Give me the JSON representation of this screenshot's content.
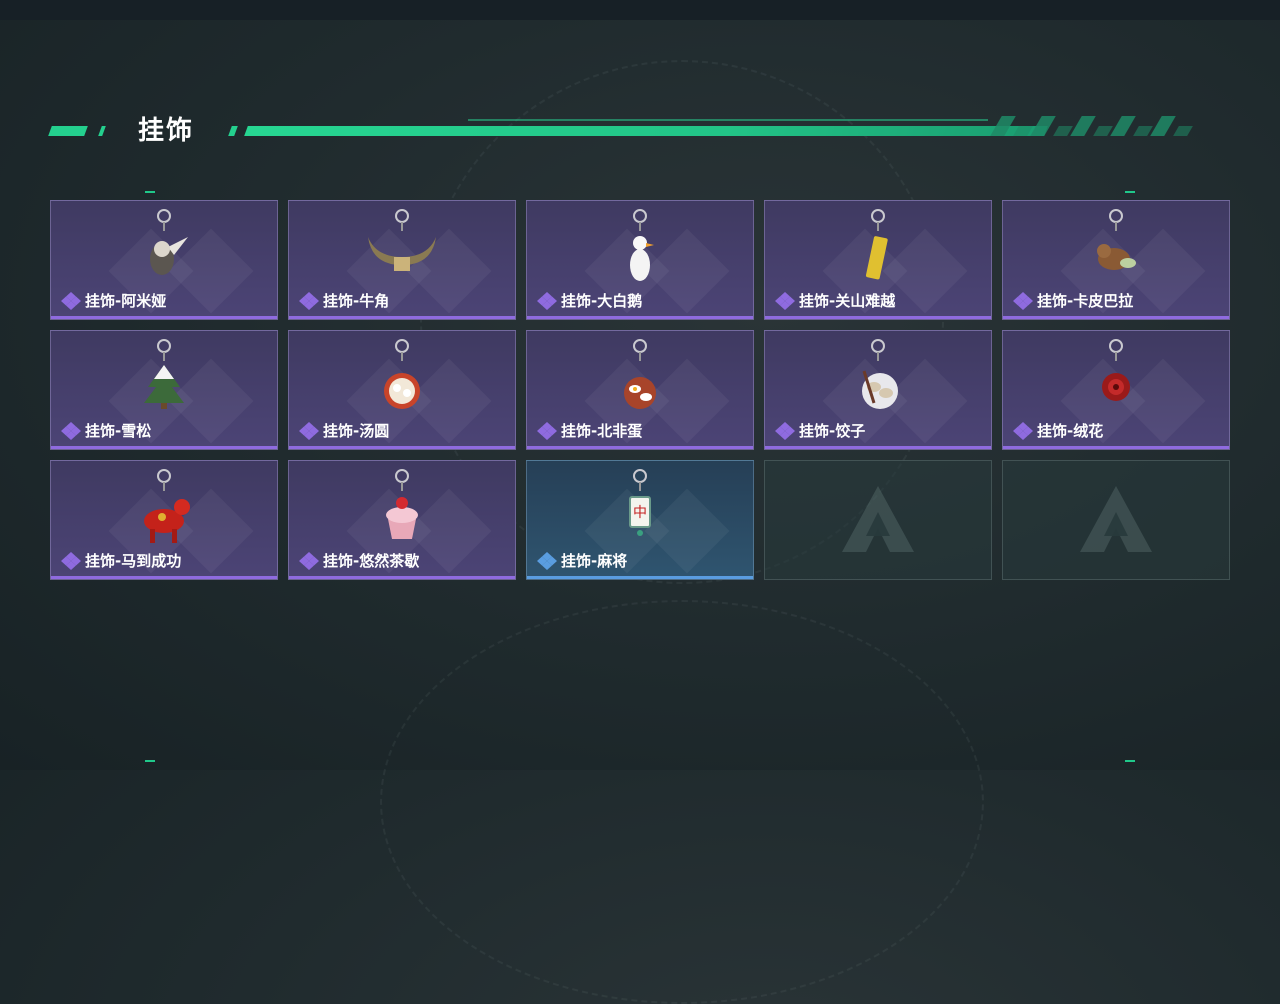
{
  "section": {
    "title": "挂饰"
  },
  "items": [
    {
      "label": "挂饰-阿米娅",
      "rarity": "purple",
      "icon": "amiya-charm-icon"
    },
    {
      "label": "挂饰-牛角",
      "rarity": "purple",
      "icon": "ox-horn-charm-icon"
    },
    {
      "label": "挂饰-大白鹅",
      "rarity": "purple",
      "icon": "white-goose-charm-icon"
    },
    {
      "label": "挂饰-关山难越",
      "rarity": "purple",
      "icon": "gold-bar-charm-icon"
    },
    {
      "label": "挂饰-卡皮巴拉",
      "rarity": "purple",
      "icon": "capybara-charm-icon"
    },
    {
      "label": "挂饰-雪松",
      "rarity": "purple",
      "icon": "snow-pine-charm-icon"
    },
    {
      "label": "挂饰-汤圆",
      "rarity": "purple",
      "icon": "tangyuan-charm-icon"
    },
    {
      "label": "挂饰-北非蛋",
      "rarity": "purple",
      "icon": "shakshuka-charm-icon"
    },
    {
      "label": "挂饰-饺子",
      "rarity": "purple",
      "icon": "dumplings-charm-icon"
    },
    {
      "label": "挂饰-绒花",
      "rarity": "purple",
      "icon": "velvet-flower-charm-icon"
    },
    {
      "label": "挂饰-马到成功",
      "rarity": "purple",
      "icon": "red-horse-charm-icon"
    },
    {
      "label": "挂饰-悠然茶歇",
      "rarity": "purple",
      "icon": "cupcake-charm-icon"
    },
    {
      "label": "挂饰-麻将",
      "rarity": "blue",
      "icon": "mahjong-tile-charm-icon"
    }
  ],
  "empty_slots": 2,
  "colors": {
    "accent": "#24d08e",
    "purple_rarity": "#8f6be0",
    "blue_rarity": "#5a9de0"
  }
}
